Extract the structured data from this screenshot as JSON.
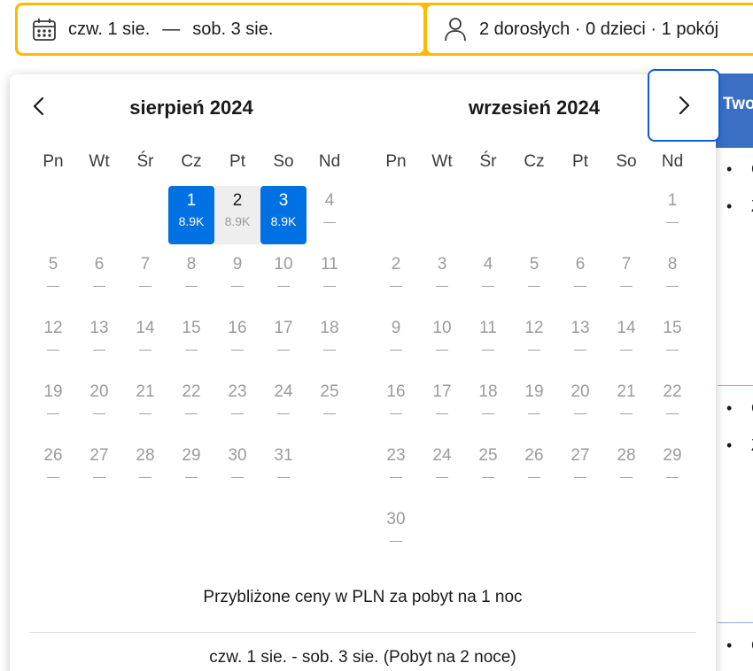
{
  "search": {
    "dates_from": "czw. 1 sie.",
    "dates_sep": "—",
    "dates_to": "sob. 3 sie.",
    "guests": "2 dorosłych · 0 dzieci · 1 pokój"
  },
  "background": {
    "blue_header_partial": "Two",
    "bullet": "•",
    "partial_chars": [
      "C",
      "Z",
      "C",
      "Z",
      "C"
    ]
  },
  "calendar": {
    "weekdays": [
      "Pn",
      "Wt",
      "Śr",
      "Cz",
      "Pt",
      "So",
      "Nd"
    ],
    "months": [
      {
        "title": "sierpień 2024",
        "offset": 3,
        "days": [
          {
            "d": "1",
            "p": "8.9K",
            "state": "sel"
          },
          {
            "d": "2",
            "p": "8.9K",
            "state": "mid"
          },
          {
            "d": "3",
            "p": "8.9K",
            "state": "sel"
          },
          {
            "d": "4",
            "p": "—"
          },
          {
            "d": "5",
            "p": "—"
          },
          {
            "d": "6",
            "p": "—"
          },
          {
            "d": "7",
            "p": "—"
          },
          {
            "d": "8",
            "p": "—"
          },
          {
            "d": "9",
            "p": "—"
          },
          {
            "d": "10",
            "p": "—"
          },
          {
            "d": "11",
            "p": "—"
          },
          {
            "d": "12",
            "p": "—"
          },
          {
            "d": "13",
            "p": "—"
          },
          {
            "d": "14",
            "p": "—"
          },
          {
            "d": "15",
            "p": "—"
          },
          {
            "d": "16",
            "p": "—"
          },
          {
            "d": "17",
            "p": "—"
          },
          {
            "d": "18",
            "p": "—"
          },
          {
            "d": "19",
            "p": "—"
          },
          {
            "d": "20",
            "p": "—"
          },
          {
            "d": "21",
            "p": "—"
          },
          {
            "d": "22",
            "p": "—"
          },
          {
            "d": "23",
            "p": "—"
          },
          {
            "d": "24",
            "p": "—"
          },
          {
            "d": "25",
            "p": "—"
          },
          {
            "d": "26",
            "p": "—"
          },
          {
            "d": "27",
            "p": "—"
          },
          {
            "d": "28",
            "p": "—"
          },
          {
            "d": "29",
            "p": "—"
          },
          {
            "d": "30",
            "p": "—"
          },
          {
            "d": "31",
            "p": "—"
          }
        ]
      },
      {
        "title": "wrzesień 2024",
        "offset": 6,
        "days": [
          {
            "d": "1",
            "p": "—"
          },
          {
            "d": "2",
            "p": "—"
          },
          {
            "d": "3",
            "p": "—"
          },
          {
            "d": "4",
            "p": "—"
          },
          {
            "d": "5",
            "p": "—"
          },
          {
            "d": "6",
            "p": "—"
          },
          {
            "d": "7",
            "p": "—"
          },
          {
            "d": "8",
            "p": "—"
          },
          {
            "d": "9",
            "p": "—"
          },
          {
            "d": "10",
            "p": "—"
          },
          {
            "d": "11",
            "p": "—"
          },
          {
            "d": "12",
            "p": "—"
          },
          {
            "d": "13",
            "p": "—"
          },
          {
            "d": "14",
            "p": "—"
          },
          {
            "d": "15",
            "p": "—"
          },
          {
            "d": "16",
            "p": "—"
          },
          {
            "d": "17",
            "p": "—"
          },
          {
            "d": "18",
            "p": "—"
          },
          {
            "d": "19",
            "p": "—"
          },
          {
            "d": "20",
            "p": "—"
          },
          {
            "d": "21",
            "p": "—"
          },
          {
            "d": "22",
            "p": "—"
          },
          {
            "d": "23",
            "p": "—"
          },
          {
            "d": "24",
            "p": "—"
          },
          {
            "d": "25",
            "p": "—"
          },
          {
            "d": "26",
            "p": "—"
          },
          {
            "d": "27",
            "p": "—"
          },
          {
            "d": "28",
            "p": "—"
          },
          {
            "d": "29",
            "p": "—"
          },
          {
            "d": "30",
            "p": "—"
          }
        ]
      }
    ],
    "price_note": "Przybliżone ceny w PLN za pobyt na 1 noc",
    "selection_summary": "czw. 1 sie. - sob. 3 sie. (Pobyt na 2 noce)"
  },
  "colors": {
    "accent": "#0071e2",
    "search_border": "#febb02",
    "focus_ring": "#0b5ed7",
    "range_mid": "#eeeeee"
  }
}
